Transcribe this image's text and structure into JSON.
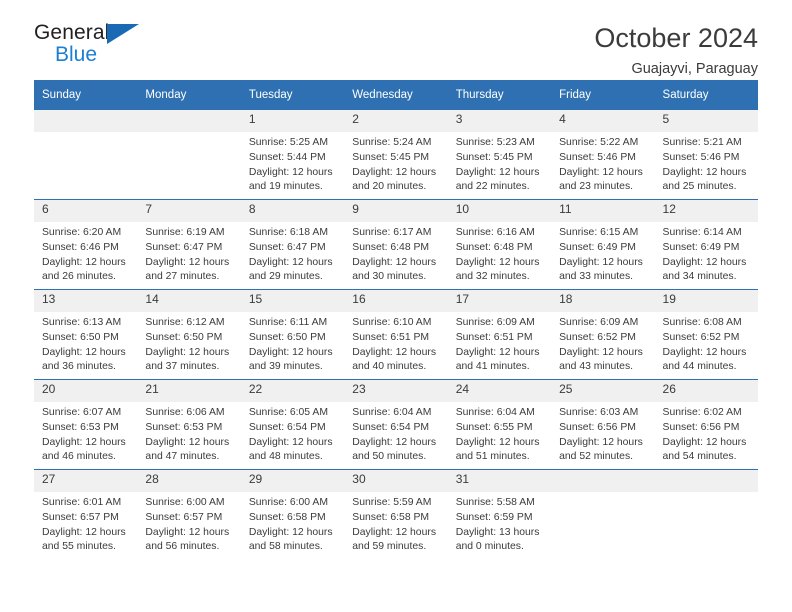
{
  "logo": {
    "word_one": "General",
    "word_two": "Blue",
    "triangle_color": "#1a69b5",
    "blue_text_color": "#1b7fd4"
  },
  "header": {
    "title": "October 2024",
    "subtitle": "Guajayvi, Paraguay"
  },
  "theme": {
    "header_blue": "#2e70b2",
    "daynum_gray": "#f0f0f0",
    "text": "#3b3b3b"
  },
  "labels": {
    "sunrise_prefix": "Sunrise:",
    "sunset_prefix": "Sunset:",
    "daylight_prefix": "Daylight:"
  },
  "weekday_headers": [
    "Sunday",
    "Monday",
    "Tuesday",
    "Wednesday",
    "Thursday",
    "Friday",
    "Saturday"
  ],
  "weeks": [
    [
      {
        "day": "",
        "sunrise": "",
        "sunset": "",
        "daylight_line1": "",
        "daylight_line2": ""
      },
      {
        "day": "",
        "sunrise": "",
        "sunset": "",
        "daylight_line1": "",
        "daylight_line2": ""
      },
      {
        "day": "1",
        "sunrise": "Sunrise: 5:25 AM",
        "sunset": "Sunset: 5:44 PM",
        "daylight_line1": "Daylight: 12 hours",
        "daylight_line2": "and 19 minutes."
      },
      {
        "day": "2",
        "sunrise": "Sunrise: 5:24 AM",
        "sunset": "Sunset: 5:45 PM",
        "daylight_line1": "Daylight: 12 hours",
        "daylight_line2": "and 20 minutes."
      },
      {
        "day": "3",
        "sunrise": "Sunrise: 5:23 AM",
        "sunset": "Sunset: 5:45 PM",
        "daylight_line1": "Daylight: 12 hours",
        "daylight_line2": "and 22 minutes."
      },
      {
        "day": "4",
        "sunrise": "Sunrise: 5:22 AM",
        "sunset": "Sunset: 5:46 PM",
        "daylight_line1": "Daylight: 12 hours",
        "daylight_line2": "and 23 minutes."
      },
      {
        "day": "5",
        "sunrise": "Sunrise: 5:21 AM",
        "sunset": "Sunset: 5:46 PM",
        "daylight_line1": "Daylight: 12 hours",
        "daylight_line2": "and 25 minutes."
      }
    ],
    [
      {
        "day": "6",
        "sunrise": "Sunrise: 6:20 AM",
        "sunset": "Sunset: 6:46 PM",
        "daylight_line1": "Daylight: 12 hours",
        "daylight_line2": "and 26 minutes."
      },
      {
        "day": "7",
        "sunrise": "Sunrise: 6:19 AM",
        "sunset": "Sunset: 6:47 PM",
        "daylight_line1": "Daylight: 12 hours",
        "daylight_line2": "and 27 minutes."
      },
      {
        "day": "8",
        "sunrise": "Sunrise: 6:18 AM",
        "sunset": "Sunset: 6:47 PM",
        "daylight_line1": "Daylight: 12 hours",
        "daylight_line2": "and 29 minutes."
      },
      {
        "day": "9",
        "sunrise": "Sunrise: 6:17 AM",
        "sunset": "Sunset: 6:48 PM",
        "daylight_line1": "Daylight: 12 hours",
        "daylight_line2": "and 30 minutes."
      },
      {
        "day": "10",
        "sunrise": "Sunrise: 6:16 AM",
        "sunset": "Sunset: 6:48 PM",
        "daylight_line1": "Daylight: 12 hours",
        "daylight_line2": "and 32 minutes."
      },
      {
        "day": "11",
        "sunrise": "Sunrise: 6:15 AM",
        "sunset": "Sunset: 6:49 PM",
        "daylight_line1": "Daylight: 12 hours",
        "daylight_line2": "and 33 minutes."
      },
      {
        "day": "12",
        "sunrise": "Sunrise: 6:14 AM",
        "sunset": "Sunset: 6:49 PM",
        "daylight_line1": "Daylight: 12 hours",
        "daylight_line2": "and 34 minutes."
      }
    ],
    [
      {
        "day": "13",
        "sunrise": "Sunrise: 6:13 AM",
        "sunset": "Sunset: 6:50 PM",
        "daylight_line1": "Daylight: 12 hours",
        "daylight_line2": "and 36 minutes."
      },
      {
        "day": "14",
        "sunrise": "Sunrise: 6:12 AM",
        "sunset": "Sunset: 6:50 PM",
        "daylight_line1": "Daylight: 12 hours",
        "daylight_line2": "and 37 minutes."
      },
      {
        "day": "15",
        "sunrise": "Sunrise: 6:11 AM",
        "sunset": "Sunset: 6:50 PM",
        "daylight_line1": "Daylight: 12 hours",
        "daylight_line2": "and 39 minutes."
      },
      {
        "day": "16",
        "sunrise": "Sunrise: 6:10 AM",
        "sunset": "Sunset: 6:51 PM",
        "daylight_line1": "Daylight: 12 hours",
        "daylight_line2": "and 40 minutes."
      },
      {
        "day": "17",
        "sunrise": "Sunrise: 6:09 AM",
        "sunset": "Sunset: 6:51 PM",
        "daylight_line1": "Daylight: 12 hours",
        "daylight_line2": "and 41 minutes."
      },
      {
        "day": "18",
        "sunrise": "Sunrise: 6:09 AM",
        "sunset": "Sunset: 6:52 PM",
        "daylight_line1": "Daylight: 12 hours",
        "daylight_line2": "and 43 minutes."
      },
      {
        "day": "19",
        "sunrise": "Sunrise: 6:08 AM",
        "sunset": "Sunset: 6:52 PM",
        "daylight_line1": "Daylight: 12 hours",
        "daylight_line2": "and 44 minutes."
      }
    ],
    [
      {
        "day": "20",
        "sunrise": "Sunrise: 6:07 AM",
        "sunset": "Sunset: 6:53 PM",
        "daylight_line1": "Daylight: 12 hours",
        "daylight_line2": "and 46 minutes."
      },
      {
        "day": "21",
        "sunrise": "Sunrise: 6:06 AM",
        "sunset": "Sunset: 6:53 PM",
        "daylight_line1": "Daylight: 12 hours",
        "daylight_line2": "and 47 minutes."
      },
      {
        "day": "22",
        "sunrise": "Sunrise: 6:05 AM",
        "sunset": "Sunset: 6:54 PM",
        "daylight_line1": "Daylight: 12 hours",
        "daylight_line2": "and 48 minutes."
      },
      {
        "day": "23",
        "sunrise": "Sunrise: 6:04 AM",
        "sunset": "Sunset: 6:54 PM",
        "daylight_line1": "Daylight: 12 hours",
        "daylight_line2": "and 50 minutes."
      },
      {
        "day": "24",
        "sunrise": "Sunrise: 6:04 AM",
        "sunset": "Sunset: 6:55 PM",
        "daylight_line1": "Daylight: 12 hours",
        "daylight_line2": "and 51 minutes."
      },
      {
        "day": "25",
        "sunrise": "Sunrise: 6:03 AM",
        "sunset": "Sunset: 6:56 PM",
        "daylight_line1": "Daylight: 12 hours",
        "daylight_line2": "and 52 minutes."
      },
      {
        "day": "26",
        "sunrise": "Sunrise: 6:02 AM",
        "sunset": "Sunset: 6:56 PM",
        "daylight_line1": "Daylight: 12 hours",
        "daylight_line2": "and 54 minutes."
      }
    ],
    [
      {
        "day": "27",
        "sunrise": "Sunrise: 6:01 AM",
        "sunset": "Sunset: 6:57 PM",
        "daylight_line1": "Daylight: 12 hours",
        "daylight_line2": "and 55 minutes."
      },
      {
        "day": "28",
        "sunrise": "Sunrise: 6:00 AM",
        "sunset": "Sunset: 6:57 PM",
        "daylight_line1": "Daylight: 12 hours",
        "daylight_line2": "and 56 minutes."
      },
      {
        "day": "29",
        "sunrise": "Sunrise: 6:00 AM",
        "sunset": "Sunset: 6:58 PM",
        "daylight_line1": "Daylight: 12 hours",
        "daylight_line2": "and 58 minutes."
      },
      {
        "day": "30",
        "sunrise": "Sunrise: 5:59 AM",
        "sunset": "Sunset: 6:58 PM",
        "daylight_line1": "Daylight: 12 hours",
        "daylight_line2": "and 59 minutes."
      },
      {
        "day": "31",
        "sunrise": "Sunrise: 5:58 AM",
        "sunset": "Sunset: 6:59 PM",
        "daylight_line1": "Daylight: 13 hours",
        "daylight_line2": "and 0 minutes."
      },
      {
        "day": "",
        "sunrise": "",
        "sunset": "",
        "daylight_line1": "",
        "daylight_line2": ""
      },
      {
        "day": "",
        "sunrise": "",
        "sunset": "",
        "daylight_line1": "",
        "daylight_line2": ""
      }
    ]
  ]
}
